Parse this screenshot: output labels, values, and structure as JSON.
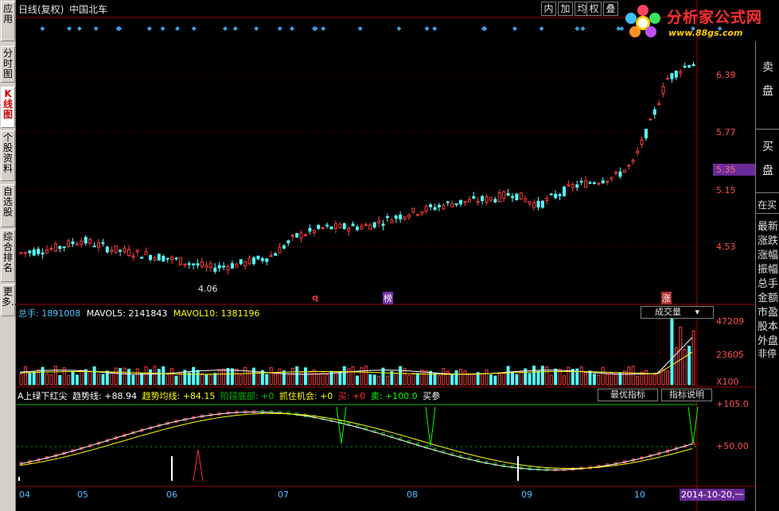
{
  "sidebar": {
    "tabs": [
      {
        "label": "应用",
        "name": "tab-apps"
      },
      {
        "label": "分时图",
        "name": "tab-intraday"
      },
      {
        "label": "K线图",
        "name": "tab-kline"
      },
      {
        "label": "个股资料",
        "name": "tab-stock-info"
      },
      {
        "label": "自选股",
        "name": "tab-watchlist"
      },
      {
        "label": "综合排名",
        "name": "tab-ranking"
      },
      {
        "label": "更多..",
        "name": "tab-more"
      }
    ]
  },
  "header": {
    "period": "日线(复权)",
    "stock_name": "中国北车",
    "tool_buttons": [
      "内",
      "加",
      "均",
      "权",
      "叠"
    ]
  },
  "logo": {
    "title": "分析家公式网",
    "url": "www.88gs.com"
  },
  "price_axis": {
    "labels": [
      "6.39",
      "5.77",
      "5.15",
      "4.53"
    ],
    "current_price": "5.35",
    "low_marker": "4.06"
  },
  "chart_markers": {
    "q": "q",
    "bang": "榜",
    "zhang": "涨"
  },
  "volume_panel": {
    "total_label": "总手:",
    "total_value": "1891008",
    "mavol5_label": "MAVOL5:",
    "mavol5_value": "2141843",
    "mavol10_label": "MAVOL10:",
    "mavol10_value": "1381196",
    "dropdown_label": "成交量",
    "axis_top": "47209",
    "axis_mid": "23605",
    "axis_unit": "X100"
  },
  "indicator_panel": {
    "name": "A上绿下红尖",
    "trend_label": "趋势线:",
    "trend_value": "+88.94",
    "trend_avg_label": "趋势均线:",
    "trend_avg_value": "+84.15",
    "bottom_label": "阶段底部:",
    "bottom_value": "+0",
    "chance_label": "抓住机会:",
    "chance_value": "+0",
    "sell_label": "买:",
    "sell_value": "+0",
    "buy_label": "卖:",
    "buy_value": "+100.0",
    "ref_label": "买参",
    "best_button": "最优指标",
    "help_button": "指标说明",
    "axis_top": "+105.0",
    "axis_mid": "+50.00"
  },
  "date_axis": {
    "labels": [
      "04",
      "05",
      "06",
      "07",
      "08",
      "09",
      "10"
    ],
    "current_date": "2014-10-20,一"
  },
  "right_panel": {
    "sell_label": [
      "卖",
      "盘"
    ],
    "buy_label": [
      "买",
      "盘"
    ],
    "rows": [
      "在买",
      "最新",
      "涨跌",
      "涨幅",
      "振幅",
      "总手",
      "金额",
      "市盈",
      "股本",
      "外盘",
      "非停"
    ]
  },
  "colors": {
    "up": "#ff3c3c",
    "down": "#54ffff",
    "ma5": "#ffffff",
    "ma10": "#ffff00",
    "axis_text": "#ff5050",
    "date_text": "#4fc0ff"
  },
  "chart_data": {
    "type": "candlestick",
    "yaxis_ticks": [
      6.39,
      5.77,
      5.15,
      4.53
    ],
    "ylim": [
      4.0,
      6.75
    ],
    "current_price": 5.35,
    "low_marker_value": 4.06,
    "series_trend": {
      "trend": 88.94,
      "trend_avg": 84.15
    },
    "volume_ylim": [
      0,
      47209
    ]
  }
}
